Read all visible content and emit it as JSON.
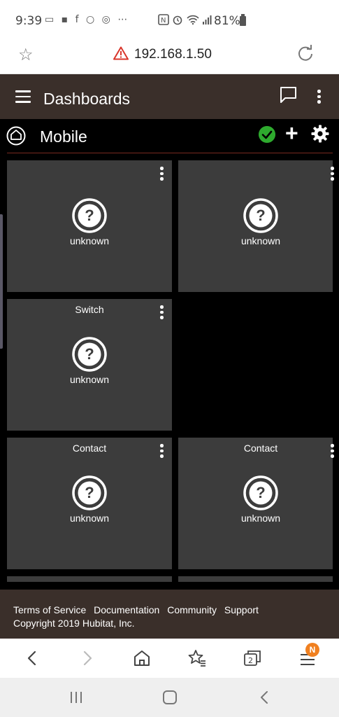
{
  "status_bar": {
    "time": "9:39",
    "left_icons": "▭ ▪ f ○ ◎ ⋯",
    "right_icons": [
      "nfc-icon",
      "alarm-icon",
      "wifi-icon",
      "signal-icon"
    ],
    "battery": "81%"
  },
  "browser": {
    "url": "192.168.1.50",
    "warning_icon": "warning-triangle-icon",
    "tab_count": "2",
    "notification_badge": "N"
  },
  "header": {
    "title": "Dashboards"
  },
  "dashboard": {
    "name": "Mobile",
    "status_color": "#2eaa2e"
  },
  "tiles": [
    {
      "label": "",
      "state": "unknown"
    },
    {
      "label": "",
      "state": "unknown"
    },
    {
      "label": "Switch",
      "state": "unknown"
    },
    {
      "label": "Contact",
      "state": "unknown"
    },
    {
      "label": "Contact",
      "state": "unknown"
    }
  ],
  "footer": {
    "links": [
      "Terms of Service",
      "Documentation",
      "Community",
      "Support"
    ],
    "copyright": "Copyright 2019 Hubitat, Inc."
  },
  "colors": {
    "header_bg": "#3a2f2a",
    "tile_bg": "#3c3c3c",
    "accent_divider": "#7a2a20",
    "badge": "#f08020"
  }
}
